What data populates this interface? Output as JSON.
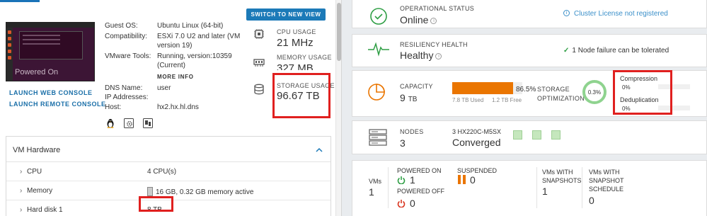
{
  "vm": {
    "thumbnail_status": "Powered On",
    "launch_web_console": "LAUNCH WEB CONSOLE",
    "launch_remote_console": "LAUNCH REMOTE CONSOLE",
    "switch_view": "SWITCH TO NEW VIEW",
    "details": {
      "guest_os_label": "Guest OS:",
      "guest_os_value": "Ubuntu Linux (64-bit)",
      "compatibility_label": "Compatibility:",
      "compatibility_value_1": "ESXi 7.0 U2 and later (VM",
      "compatibility_value_2": "version 19)",
      "tools_label": "VMware Tools:",
      "tools_value_1": "Running, version:10359",
      "tools_value_2": "(Current)",
      "more_info": "MORE INFO",
      "dns_label": "DNS Name:",
      "dns_value": "user",
      "ip_label": "IP Addresses:",
      "ip_value": "",
      "host_label": "Host:",
      "host_value": "hx2.hx.hl.dns"
    },
    "usage": {
      "cpu_label": "CPU USAGE",
      "cpu_value": "21 MHz",
      "memory_label": "MEMORY USAGE",
      "memory_value": "327 MB",
      "storage_label": "STORAGE USAGE",
      "storage_value": "96.67 TB"
    },
    "hardware": {
      "title": "VM Hardware",
      "rows": [
        {
          "name": "CPU",
          "value": "4 CPU(s)"
        },
        {
          "name": "Memory",
          "value": "16 GB, 0.32 GB memory active"
        },
        {
          "name": "Hard disk 1",
          "value": "8 TB"
        }
      ]
    }
  },
  "cluster": {
    "operational": {
      "label": "OPERATIONAL STATUS",
      "value": "Online",
      "license_note": "Cluster License not registered"
    },
    "resiliency": {
      "label": "RESILIENCY HEALTH",
      "value": "Healthy",
      "tolerance_note": "1 Node failure can be tolerated"
    },
    "capacity": {
      "label": "CAPACITY",
      "value": "9",
      "unit": "TB",
      "used_percent": 86.5,
      "percent_text": "86.5%",
      "used_text": "7.8 TB Used",
      "free_text": "1.2 TB Free",
      "optimization_label_1": "STORAGE",
      "optimization_label_2": "OPTIMIZATION",
      "optimization_value": "0.3%",
      "compression_label": "Compression",
      "compression_value": "0%",
      "dedup_label": "Deduplication",
      "dedup_value": "0%"
    },
    "nodes": {
      "label": "NODES",
      "value": "3",
      "model": "3 HX220C-M5SX",
      "status": "Converged"
    },
    "vms": {
      "total_label": "VMs",
      "total_value": "1",
      "powered_on_label": "POWERED ON",
      "powered_on_value": "1",
      "powered_off_label": "POWERED OFF",
      "powered_off_value": "0",
      "suspended_label": "SUSPENDED",
      "suspended_value": "0",
      "snapshots_label_1": "VMs WITH",
      "snapshots_label_2": "SNAPSHOTS",
      "snapshots_value": "1",
      "schedule_label_1": "VMs WITH",
      "schedule_label_2": "SNAPSHOT",
      "schedule_label_3": "SCHEDULE",
      "schedule_value": "0"
    }
  },
  "colors": {
    "accent": "#1c7ab8",
    "highlight": "#e0201f",
    "capacity_bar": "#ea7500",
    "ok_green": "#2e9e44"
  }
}
